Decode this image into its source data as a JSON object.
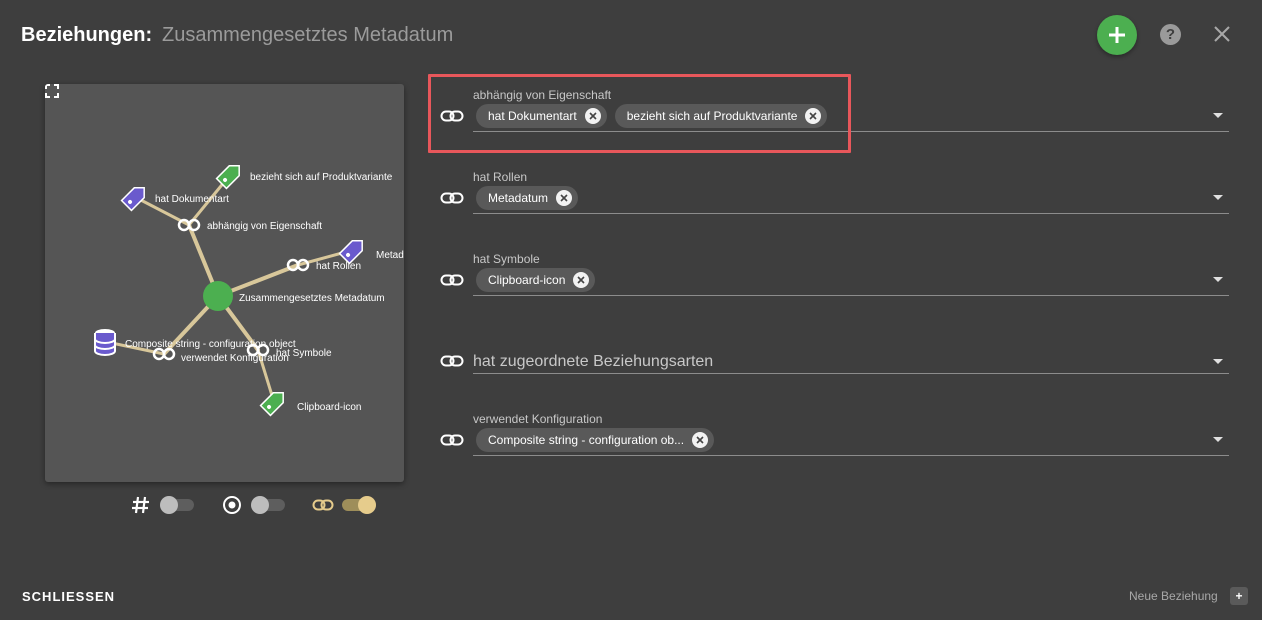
{
  "header": {
    "title": "Beziehungen:",
    "subtitle": "Zusammengesetztes Metadatum",
    "add_icon": "plus-icon",
    "help_icon": "help-circle-icon",
    "close_icon": "close-icon"
  },
  "graph": {
    "center": "Zusammengesetztes Metadatum",
    "links": [
      "abhängig von Eigenschaft",
      "hat Rollen",
      "hat Symbole",
      "verwendet Konfiguration"
    ],
    "nodes": [
      "hat Dokumentart",
      "bezieht sich auf Produktvariante",
      "Metad",
      "Clipboard-icon",
      "Composite string - configuration object"
    ],
    "colors": {
      "edge": "#d8c79a",
      "center": "#4caf50",
      "tag_green": "#4caf50",
      "tag_purple": "#6a5acd"
    }
  },
  "toggles": [
    {
      "icon": "hash-icon",
      "state": "off"
    },
    {
      "icon": "target-icon",
      "state": "off"
    },
    {
      "icon": "link-icon",
      "state": "on"
    }
  ],
  "relations": [
    {
      "label": "abhängig von Eigenschaft",
      "chips": [
        "hat Dokumentart",
        "bezieht sich auf Produktvariante"
      ]
    },
    {
      "label": "hat Rollen",
      "chips": [
        "Metadatum"
      ]
    },
    {
      "label": "hat Symbole",
      "chips": [
        "Clipboard-icon"
      ]
    },
    {
      "placeholder": "hat zugeordnete Beziehungsarten"
    },
    {
      "label": "verwendet Konfiguration",
      "chips": [
        "Composite string - configuration ob..."
      ]
    }
  ],
  "footer": {
    "close_label": "SCHLIESSEN",
    "new_relation_label": "Neue Beziehung",
    "new_relation_icon": "+"
  },
  "colors": {
    "background": "#3e3e3e",
    "accent_green": "#4caf50",
    "highlight_red": "#e8575b"
  }
}
